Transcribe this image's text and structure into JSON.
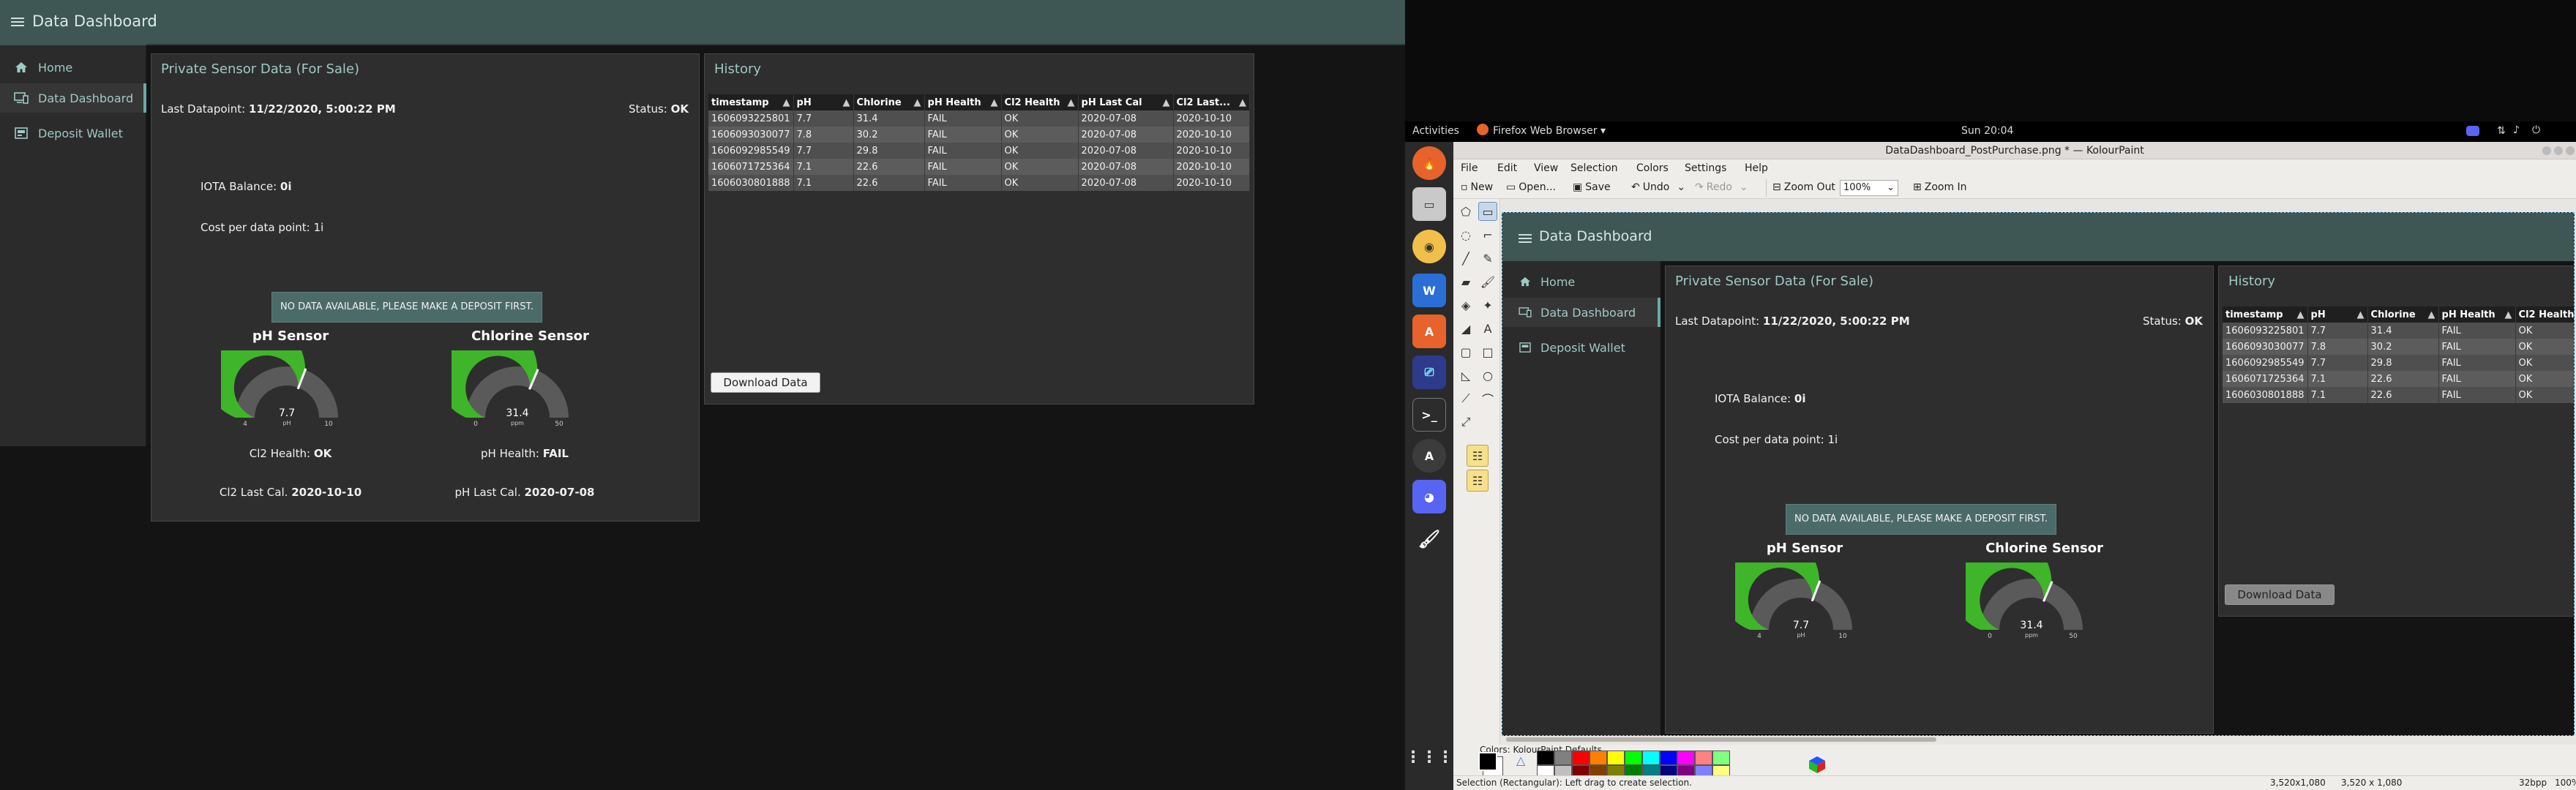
{
  "dashboard": {
    "app_title": "Data Dashboard",
    "nav": [
      {
        "label": "Home",
        "icon": "home-icon"
      },
      {
        "label": "Data Dashboard",
        "icon": "dashboard-icon"
      },
      {
        "label": "Deposit Wallet",
        "icon": "wallet-icon"
      }
    ],
    "sensor_panel": {
      "title": "Private Sensor Data (For Sale)",
      "last_datapoint_label": "Last Datapoint:",
      "last_datapoint_value": "11/22/2020, 5:00:22 PM",
      "status_label": "Status:",
      "status_value": "OK",
      "iota_label": "IOTA Balance:",
      "iota_value": "0i",
      "cost_label": "Cost per data point:",
      "cost_value": "1i",
      "banner": "NO DATA AVAILABLE, PLEASE MAKE A DEPOSIT FIRST.",
      "gauges": [
        {
          "title": "pH Sensor",
          "value": "7.7",
          "unit": "pH",
          "min": "4",
          "max": "10",
          "fraction": 0.617
        },
        {
          "title": "Chlorine Sensor",
          "value": "31.4",
          "unit": "ppm",
          "min": "0",
          "max": "50",
          "fraction": 0.628
        }
      ],
      "cl2_health_label": "Cl2 Health:",
      "cl2_health_value": "OK",
      "ph_health_label": "pH Health:",
      "ph_health_value": "FAIL",
      "cl2_cal_label": "Cl2 Last Cal.",
      "cl2_cal_value": "2020-10-10",
      "ph_cal_label": "pH Last Cal.",
      "ph_cal_value": "2020-07-08"
    },
    "history": {
      "title": "History",
      "columns": [
        "timestamp",
        "pH",
        "Chlorine",
        "pH Health",
        "Cl2 Health",
        "pH Last Cal",
        "Cl2 Last..."
      ],
      "rows": [
        [
          "1606093225801",
          "7.7",
          "31.4",
          "FAIL",
          "OK",
          "2020-07-08",
          "2020-10-10"
        ],
        [
          "1606093030077",
          "7.8",
          "30.2",
          "FAIL",
          "OK",
          "2020-07-08",
          "2020-10-10"
        ],
        [
          "1606092985549",
          "7.7",
          "29.8",
          "FAIL",
          "OK",
          "2020-07-08",
          "2020-10-10"
        ],
        [
          "1606071725364",
          "7.1",
          "22.6",
          "FAIL",
          "OK",
          "2020-07-08",
          "2020-10-10"
        ],
        [
          "1606030801888",
          "7.1",
          "22.6",
          "FAIL",
          "OK",
          "2020-07-08",
          "2020-10-10"
        ]
      ],
      "download_label": "Download Data"
    }
  },
  "desktop": {
    "activities": "Activities",
    "app_menu": "Firefox Web Browser ▾",
    "clock": "Sun 20:04",
    "window_title": "DataDashboard_PostPurchase.png * — KolourPaint",
    "menu": [
      "File",
      "Edit",
      "View",
      "Selection",
      "Colors",
      "Settings",
      "Help"
    ],
    "toolbar": {
      "new": "New",
      "open": "Open...",
      "save": "Save",
      "undo": "Undo",
      "redo": "Redo",
      "zoom_out": "Zoom Out",
      "zoom_value": "100%",
      "zoom_in": "Zoom In"
    },
    "colors_title": "Colors: KolourPaint Defaults",
    "status_text": "Selection (Rectangular): Left drag to create selection.",
    "status_dims1": "3,520x1,080",
    "status_dims2": "3,520 x 1,080",
    "status_bpp": "32bpp",
    "status_zoom": "100%",
    "palette_top": [
      "#000000",
      "#808080",
      "#ff0000",
      "#ff8000",
      "#ffff00",
      "#00ff00",
      "#00ffff",
      "#0000ff",
      "#ff00ff",
      "#ff8080",
      "#80ff80"
    ],
    "palette_bottom": [
      "#ffffff",
      "#c0c0c0",
      "#800000",
      "#804000",
      "#808000",
      "#008000",
      "#008080",
      "#000080",
      "#800080",
      "#8080ff",
      "#ffff80"
    ]
  }
}
